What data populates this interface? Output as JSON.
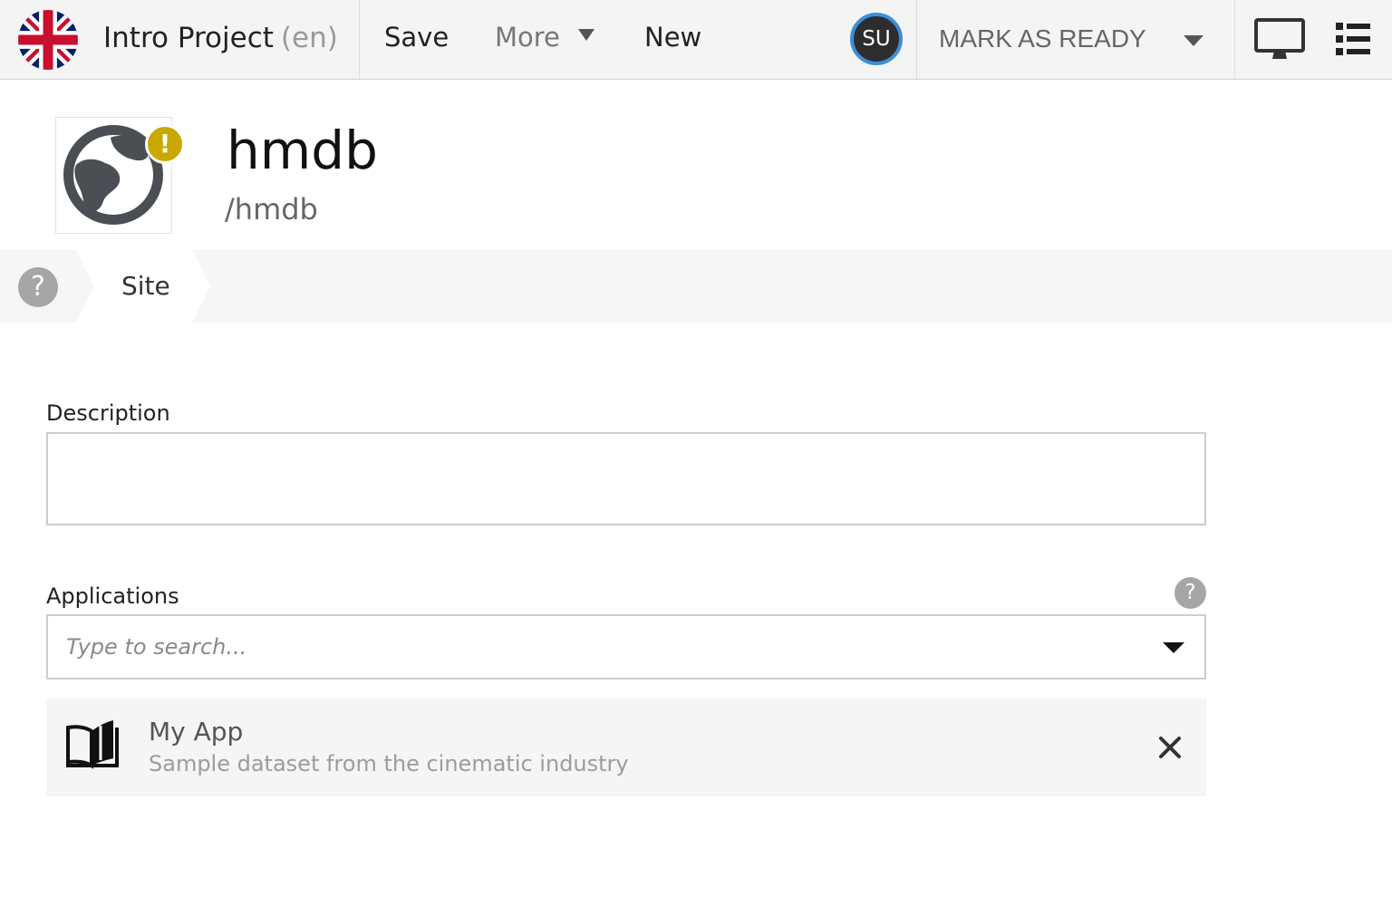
{
  "toolbar": {
    "project_name": "Intro Project",
    "project_lang": "(en)",
    "save_label": "Save",
    "more_label": "More",
    "new_label": "New",
    "user_initials": "SU",
    "mark_ready_label": "MARK AS READY",
    "flag_icon": "uk-flag-icon",
    "monitor_icon": "monitor-icon",
    "list_icon": "list-icon"
  },
  "header": {
    "title": "hmdb",
    "path": "/hmdb",
    "icon": "globe-icon",
    "badge": "!",
    "badge_color": "#c9a800"
  },
  "tabs": {
    "help_symbol": "?",
    "items": [
      {
        "label": "Site"
      }
    ]
  },
  "form": {
    "description": {
      "label": "Description",
      "value": ""
    },
    "applications": {
      "label": "Applications",
      "help_symbol": "?",
      "placeholder": "Type to search...",
      "items": [
        {
          "name": "My App",
          "description": "Sample dataset from the cinematic industry",
          "icon": "book-icon"
        }
      ]
    }
  },
  "colors": {
    "accent": "#3b8fd9",
    "avatar_bg": "#2d2d2d",
    "warning": "#c9a800"
  }
}
